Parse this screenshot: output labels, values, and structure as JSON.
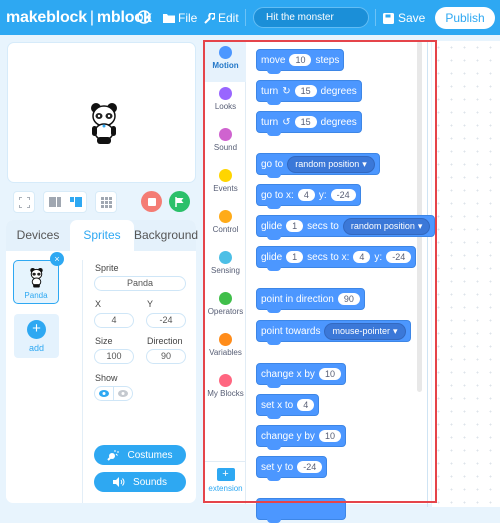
{
  "topbar": {
    "brand": "makeblock",
    "brand_sep": "|",
    "brand_product": "mblock",
    "globe_icon": "globe-icon",
    "file_label": "File",
    "edit_label": "Edit",
    "project_name": "Hit the monster",
    "save_label": "Save",
    "publish_label": "Publish",
    "accent": "#2ea8f2"
  },
  "stage": {
    "sprite_name": "Panda"
  },
  "stage_controls": {
    "fullscreen": "fullscreen-icon",
    "small_layout": "small-stage-icon",
    "large_layout": "large-stage-icon",
    "grid": "grid-icon",
    "stop_color": "#f26d6d",
    "go_color": "#2bc06a"
  },
  "tabs": [
    {
      "label": "Devices",
      "active": false
    },
    {
      "label": "Sprites",
      "active": true
    },
    {
      "label": "Background",
      "active": false
    }
  ],
  "sprites": {
    "items": [
      {
        "name": "Panda",
        "selected": true
      }
    ],
    "add_label": "add",
    "delete_symbol": "×",
    "add_symbol": "+"
  },
  "sprite_props": {
    "sprite_label": "Sprite",
    "sprite_value": "Panda",
    "x_label": "X",
    "x_value": "4",
    "y_label": "Y",
    "y_value": "-24",
    "size_label": "Size",
    "size_value": "100",
    "direction_label": "Direction",
    "direction_value": "90",
    "show_label": "Show",
    "shown": true
  },
  "buttons": {
    "costumes": "Costumes",
    "sounds": "Sounds"
  },
  "categories": [
    {
      "label": "Motion",
      "color": "#4c97ff",
      "active": true
    },
    {
      "label": "Looks",
      "color": "#9966ff",
      "active": false
    },
    {
      "label": "Sound",
      "color": "#cf63cf",
      "active": false
    },
    {
      "label": "Events",
      "color": "#ffd500",
      "active": false
    },
    {
      "label": "Control",
      "color": "#ffab19",
      "active": false
    },
    {
      "label": "Sensing",
      "color": "#4cbfe6",
      "active": false
    },
    {
      "label": "Operators",
      "color": "#40bf4a",
      "active": false
    },
    {
      "label": "Variables",
      "color": "#ff8c1a",
      "active": false
    },
    {
      "label": "My Blocks",
      "color": "#ff6680",
      "active": false
    }
  ],
  "extension": {
    "label": "extension",
    "symbol": "+"
  },
  "blocks": {
    "move": {
      "pre": "move",
      "val": "10",
      "post": "steps"
    },
    "turn_right": {
      "pre": "turn",
      "icon": "↻",
      "val": "15",
      "post": "degrees"
    },
    "turn_left": {
      "pre": "turn",
      "icon": "↺",
      "val": "15",
      "post": "degrees"
    },
    "go_to": {
      "pre": "go to",
      "drop": "random position"
    },
    "go_to_xy": {
      "pre": "go to x:",
      "x": "4",
      "mid": "y:",
      "y": "-24"
    },
    "glide_to": {
      "pre": "glide",
      "val": "1",
      "mid": "secs to",
      "drop": "random position"
    },
    "glide_xy": {
      "pre": "glide",
      "val": "1",
      "mid": "secs to x:",
      "x": "4",
      "mid2": "y:",
      "y": "-24"
    },
    "point_dir": {
      "pre": "point in direction",
      "val": "90"
    },
    "point_towards": {
      "pre": "point towards",
      "drop": "mouse-pointer"
    },
    "change_x": {
      "pre": "change x by",
      "val": "10"
    },
    "set_x": {
      "pre": "set x to",
      "val": "4"
    },
    "change_y": {
      "pre": "change y by",
      "val": "10"
    },
    "set_y": {
      "pre": "set y to",
      "val": "-24"
    },
    "dropdown_arrow": "▾"
  }
}
